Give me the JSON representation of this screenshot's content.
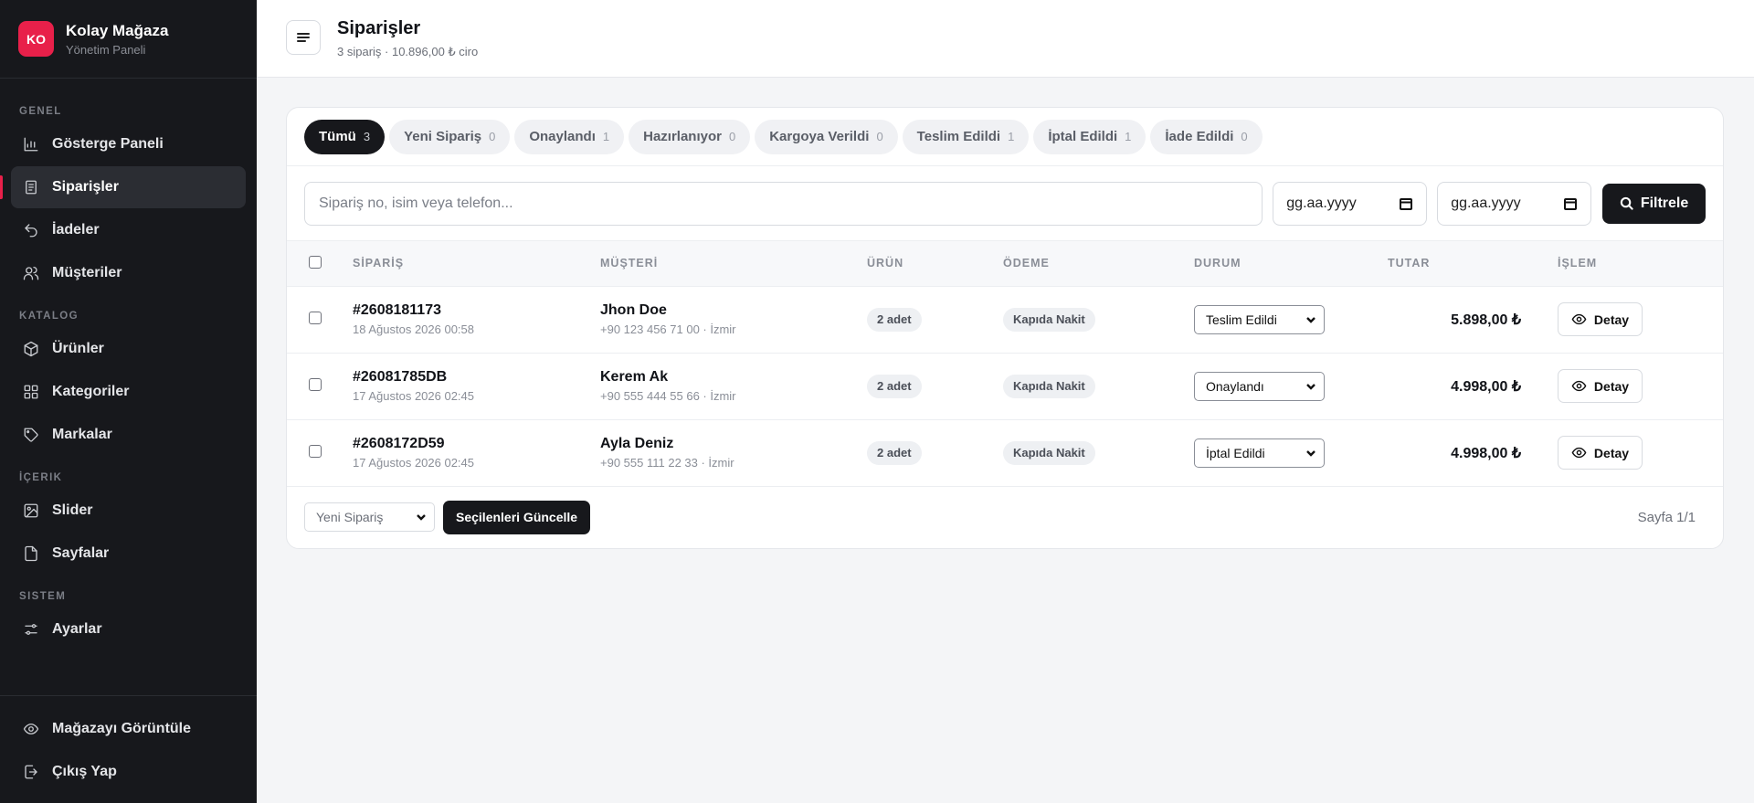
{
  "brand": {
    "logo": "KO",
    "name": "Kolay Mağaza",
    "subtitle": "Yönetim Paneli",
    "accent": "#e8204a"
  },
  "sidebar": {
    "sections": [
      {
        "title": "GENEL",
        "items": [
          {
            "label": "Gösterge Paneli",
            "icon": "chart-bar-icon"
          },
          {
            "label": "Siparişler",
            "icon": "receipt-icon",
            "active": true
          },
          {
            "label": "İadeler",
            "icon": "undo-icon"
          },
          {
            "label": "Müşteriler",
            "icon": "users-icon"
          }
        ]
      },
      {
        "title": "KATALOG",
        "items": [
          {
            "label": "Ürünler",
            "icon": "box-icon"
          },
          {
            "label": "Kategoriler",
            "icon": "grid-icon"
          },
          {
            "label": "Markalar",
            "icon": "tag-icon"
          }
        ]
      },
      {
        "title": "İÇERIK",
        "items": [
          {
            "label": "Slider",
            "icon": "image-icon"
          },
          {
            "label": "Sayfalar",
            "icon": "file-icon"
          }
        ]
      },
      {
        "title": "SISTEM",
        "items": [
          {
            "label": "Ayarlar",
            "icon": "sliders-icon"
          }
        ]
      }
    ],
    "bottom": [
      {
        "label": "Mağazayı Görüntüle",
        "icon": "eye-icon"
      },
      {
        "label": "Çıkış Yap",
        "icon": "logout-icon"
      }
    ]
  },
  "header": {
    "title": "Siparişler",
    "subtitle": "3 sipariş · 10.896,00 ₺ ciro"
  },
  "tabs": [
    {
      "label": "Tümü",
      "count": "3",
      "active": true
    },
    {
      "label": "Yeni Sipariş",
      "count": "0"
    },
    {
      "label": "Onaylandı",
      "count": "1"
    },
    {
      "label": "Hazırlanıyor",
      "count": "0"
    },
    {
      "label": "Kargoya Verildi",
      "count": "0"
    },
    {
      "label": "Teslim Edildi",
      "count": "1"
    },
    {
      "label": "İptal Edildi",
      "count": "1"
    },
    {
      "label": "İade Edildi",
      "count": "0"
    }
  ],
  "filters": {
    "search_placeholder": "Sipariş no, isim veya telefon...",
    "date_from": "gg.aa.yyyy",
    "date_to": "gg.aa.yyyy",
    "filter_label": "Filtrele"
  },
  "table": {
    "columns": [
      "SİPARİŞ",
      "MÜŞTERİ",
      "ÜRÜN",
      "ÖDEME",
      "DURUM",
      "TUTAR",
      "İŞLEM"
    ],
    "rows": [
      {
        "order_no": "#2608181173",
        "date": "18 Ağustos 2026 00:58",
        "customer": "Jhon Doe",
        "contact": "+90 123 456 71 00 · İzmir",
        "qty": "2 adet",
        "payment": "Kapıda Nakit",
        "status": "Teslim Edildi",
        "amount": "5.898,00 ₺",
        "action": "Detay"
      },
      {
        "order_no": "#26081785DB",
        "date": "17 Ağustos 2026 02:45",
        "customer": "Kerem Ak",
        "contact": "+90 555 444 55 66 · İzmir",
        "qty": "2 adet",
        "payment": "Kapıda Nakit",
        "status": "Onaylandı",
        "amount": "4.998,00 ₺",
        "action": "Detay"
      },
      {
        "order_no": "#2608172D59",
        "date": "17 Ağustos 2026 02:45",
        "customer": "Ayla Deniz",
        "contact": "+90 555 111 22 33 · İzmir",
        "qty": "2 adet",
        "payment": "Kapıda Nakit",
        "status": "İptal Edildi",
        "amount": "4.998,00 ₺",
        "action": "Detay"
      }
    ]
  },
  "footer": {
    "bulk_status": "Yeni Sipariş",
    "bulk_button": "Seçilenleri Güncelle",
    "pagination": "Sayfa 1/1"
  }
}
